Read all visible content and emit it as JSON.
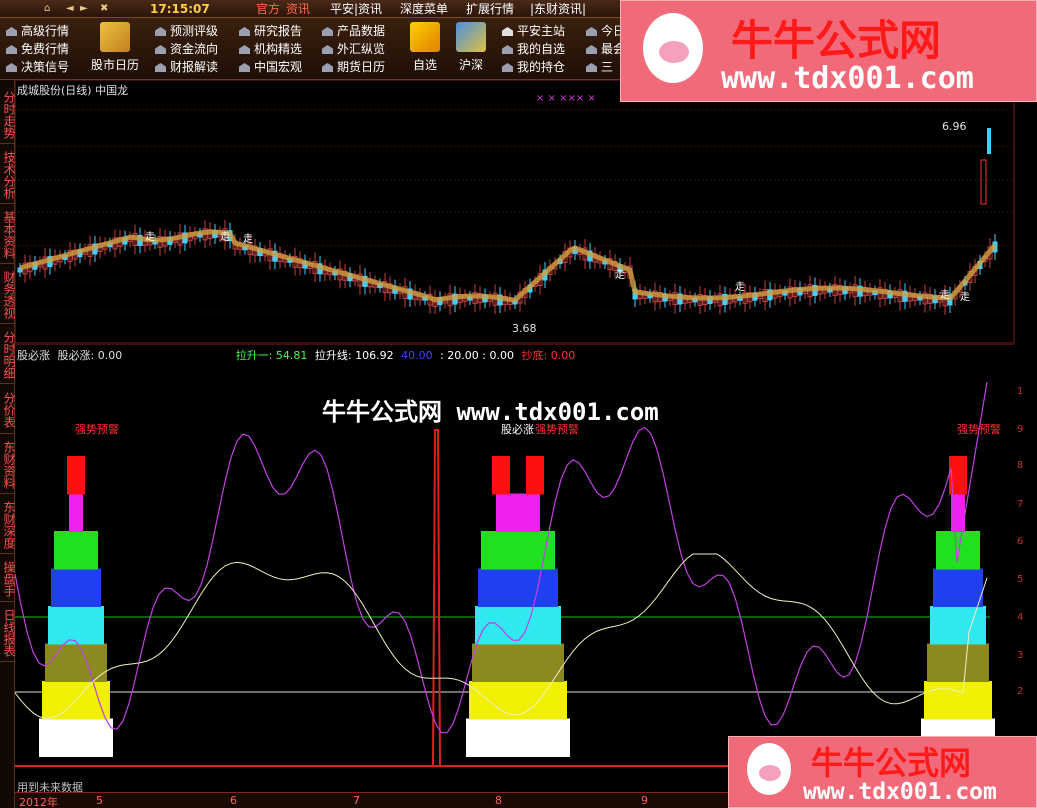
{
  "topbar": {
    "clock": "17:15:07",
    "menus": [
      {
        "label": "官方",
        "active": true
      },
      {
        "label": "资讯",
        "active": true
      },
      {
        "label": "平安|资讯",
        "active": false
      },
      {
        "label": "深度菜单",
        "active": false
      },
      {
        "label": "扩展行情",
        "active": false
      },
      {
        "label": "|东财资讯|",
        "active": false
      }
    ]
  },
  "toolbar": {
    "col1": [
      "高级行情",
      "免费行情",
      "决策信号"
    ],
    "big1": "股市日历",
    "col2": [
      "预测评级",
      "资金流向",
      "财报解读"
    ],
    "col3": [
      "研究报告",
      "机构精选",
      "中国宏观"
    ],
    "col4": [
      "产品数据",
      "外汇纵览",
      "期货日历"
    ],
    "big2": "自选",
    "big3": "沪深",
    "col5": [
      "平安主站",
      "我的自选",
      "我的持仓"
    ],
    "col6": [
      "今日",
      "最会",
      "三"
    ]
  },
  "lefttabs": [
    "分时走势",
    "技术分析",
    "基本资料",
    "财务透视",
    "分时明细",
    "分价表",
    "东财资料",
    "东财深度",
    "操盘手",
    "日线报表"
  ],
  "main": {
    "title": "成城股份(日线) 中国龙",
    "high_label": "6.96",
    "low_label": "3.68",
    "marker": "走",
    "marker_x": "× ×  ×××  ×"
  },
  "indicator": {
    "name1": "股必涨",
    "name2": "股必涨: 0.00",
    "v1": "拉升一: 54.81",
    "v2": "拉升线: 106.92",
    "v3": "40.00",
    "v4": ": 20.00 : 0.00",
    "v5": "抄底: 0.00",
    "colors": {
      "v1": "#40ff40",
      "v2": "#ffffff",
      "v3": "#4040ff",
      "v4": "#ffffff",
      "v5": "#ff3030"
    }
  },
  "sub": {
    "alert": "强势预警",
    "center_label": "股必涨",
    "center_alert": "强势预警",
    "future_note": "用到未来数据"
  },
  "yaxis_sub": [
    "1",
    "9",
    "8",
    "7",
    "6",
    "5",
    "4",
    "3",
    "2"
  ],
  "timeaxis": [
    "2012年",
    "5",
    "6",
    "7",
    "8",
    "9"
  ],
  "watermark": {
    "cn": "牛牛公式网",
    "url": "www.tdx001.com",
    "center": "牛牛公式网 www.tdx001.com"
  },
  "colors": {
    "stack": [
      "#ffffff",
      "#f0f000",
      "#8a8a20",
      "#30e8f0",
      "#2040f0",
      "#20e020",
      "#f020f0",
      "#ff1010"
    ],
    "purple_line": "#c040e0",
    "white_line": "#f0f0c0",
    "green_ref": "#20c020",
    "white_ref": "#e0e0e0"
  }
}
